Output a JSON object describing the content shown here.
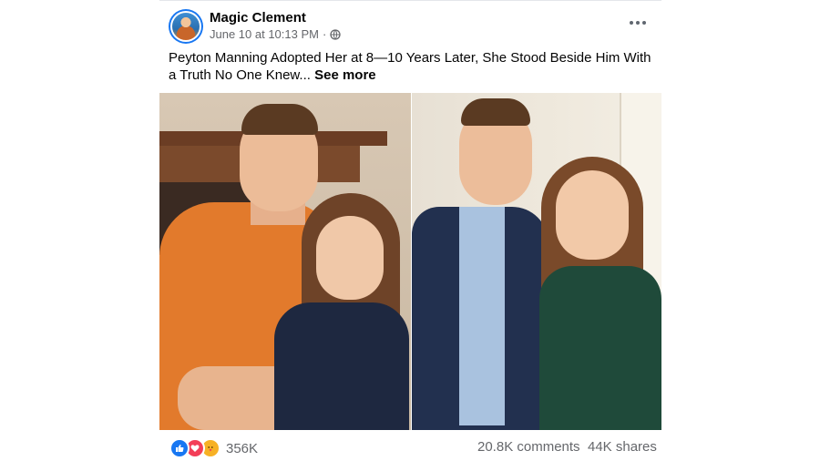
{
  "post": {
    "author": "Magic Clement",
    "timestamp": "June 10 at 10:13 PM",
    "separator": "·",
    "audience_icon": "globe-icon",
    "menu_icon": "more-horizontal-icon",
    "caption": "Peyton Manning Adopted Her at 8—10 Years Later, She Stood Beside Him With a Truth No One Knew...",
    "see_more_label": "See more"
  },
  "engagement": {
    "reaction_icons": [
      "like-icon",
      "love-icon",
      "care-icon"
    ],
    "reaction_count": "356K",
    "comments": "20.8K comments",
    "shares": "44K shares"
  },
  "colors": {
    "like": "#1877f2",
    "love": "#f33e58",
    "care": "#f7b125",
    "secondary_text": "#65676b"
  }
}
